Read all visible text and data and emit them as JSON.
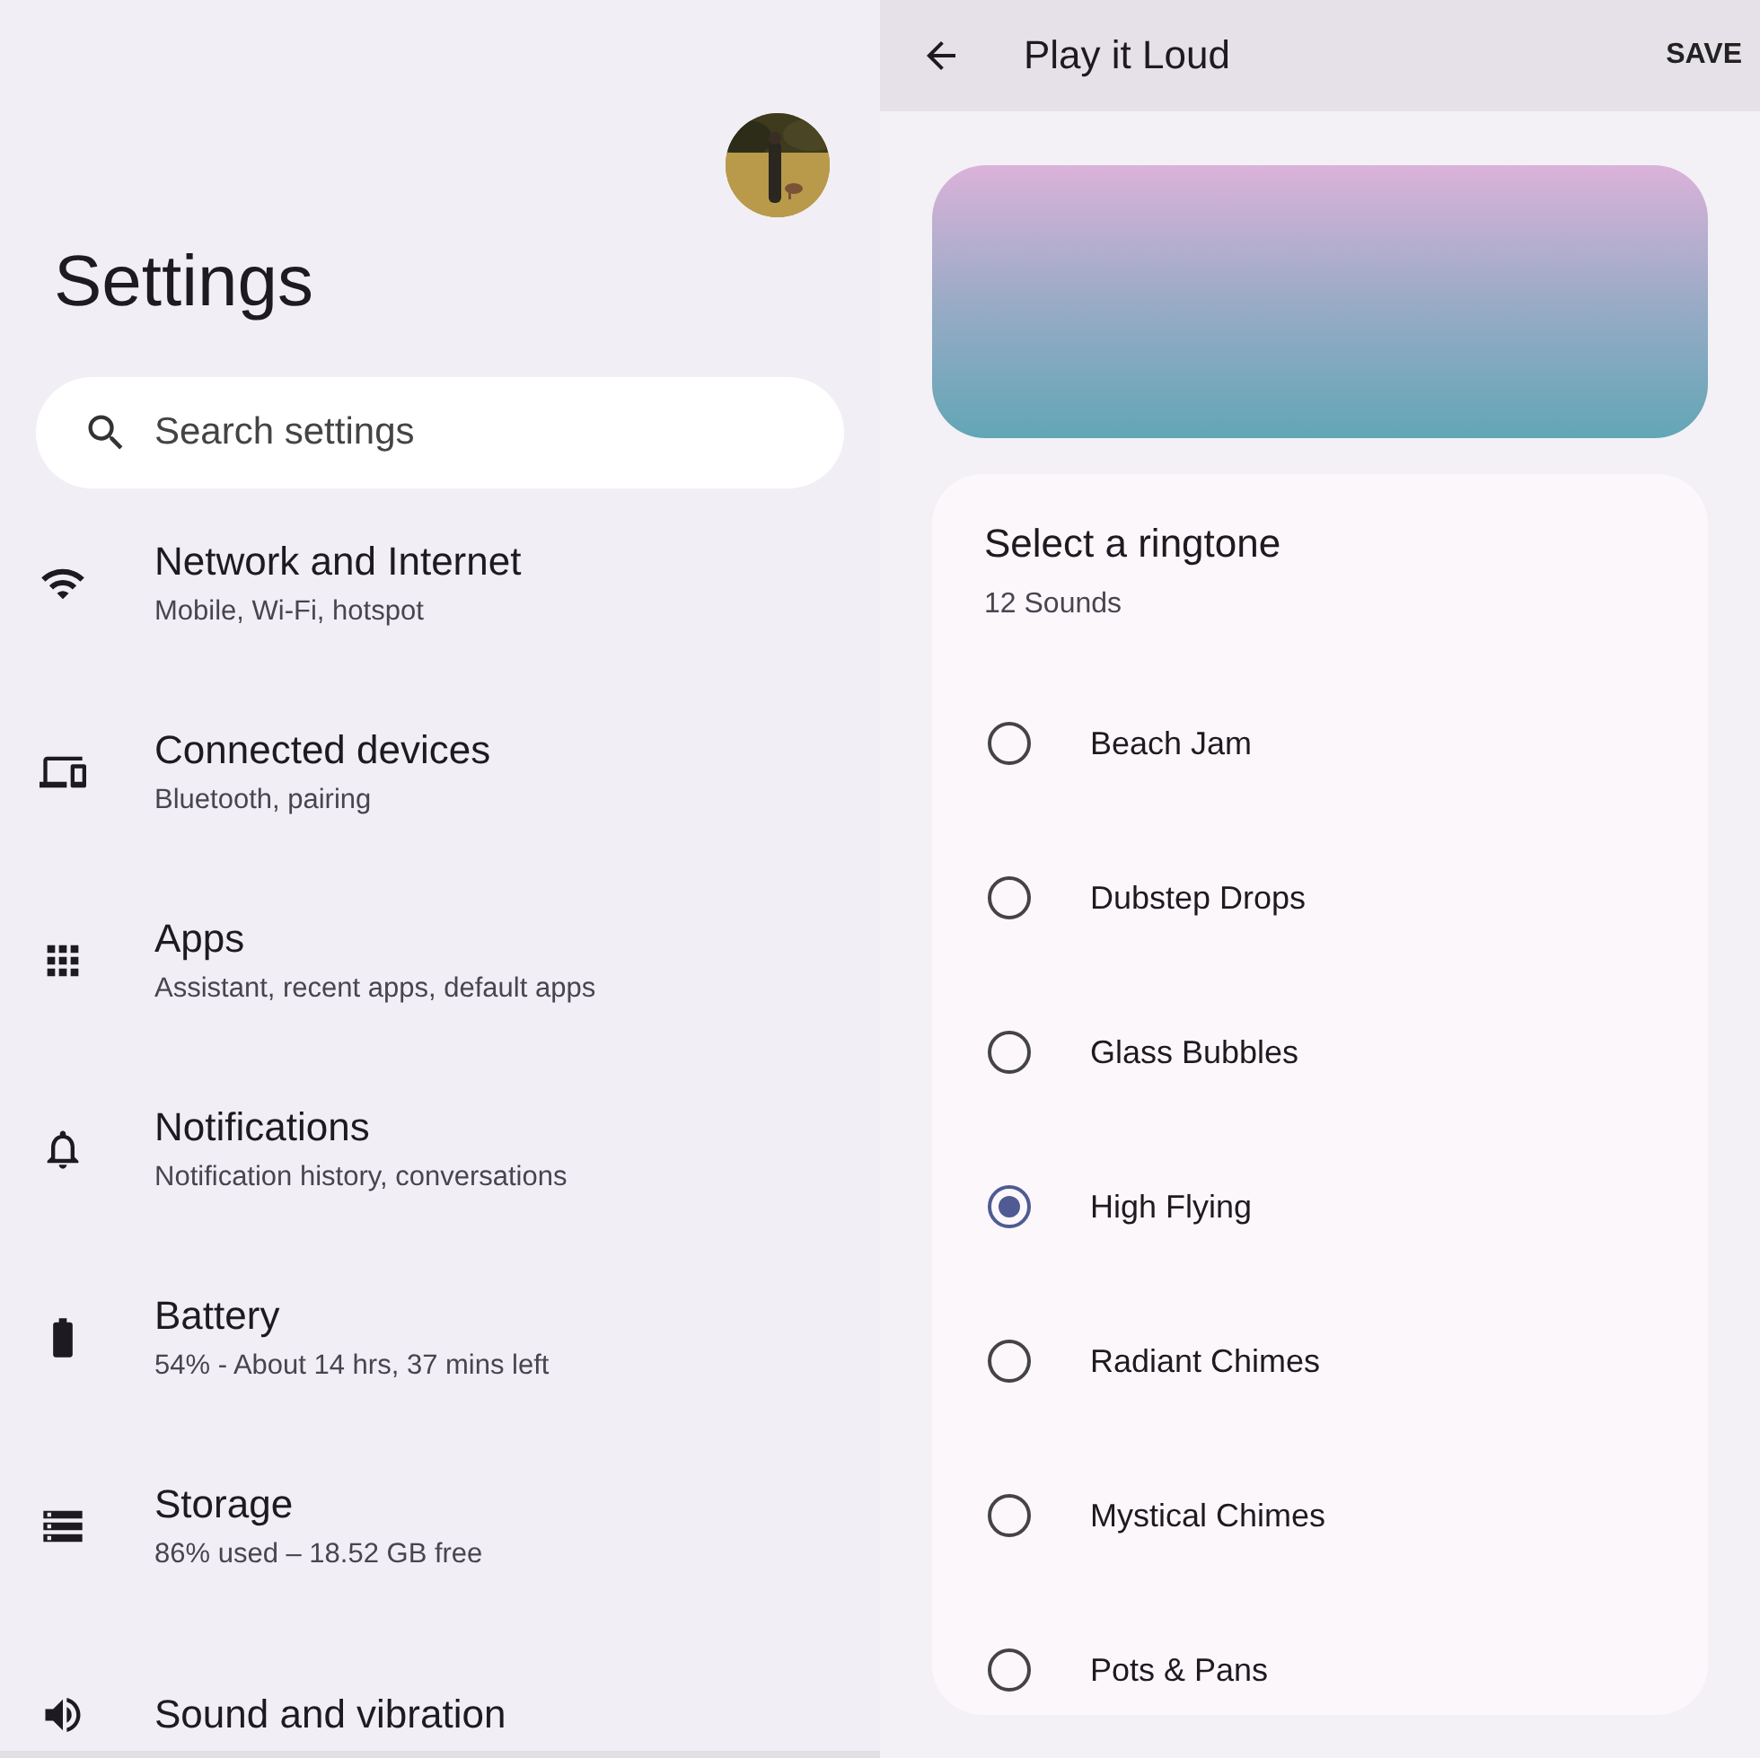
{
  "settings": {
    "title": "Settings",
    "search": {
      "placeholder": "Search settings"
    },
    "items": [
      {
        "title": "Network and Internet",
        "subtitle": "Mobile, Wi-Fi, hotspot"
      },
      {
        "title": "Connected devices",
        "subtitle": "Bluetooth, pairing"
      },
      {
        "title": "Apps",
        "subtitle": "Assistant, recent apps, default apps"
      },
      {
        "title": "Notifications",
        "subtitle": "Notification history, conversations"
      },
      {
        "title": "Battery",
        "subtitle": "54% - About 14 hrs, 37 mins left"
      },
      {
        "title": "Storage",
        "subtitle": "86% used – 18.52 GB free"
      },
      {
        "title": "Sound and vibration"
      }
    ]
  },
  "ringtone": {
    "app_bar": {
      "title": "Play it Loud",
      "action": "SAVE"
    },
    "card": {
      "title": "Select a ringtone",
      "count": "12 Sounds",
      "options": [
        {
          "label": "Beach Jam",
          "selected": false
        },
        {
          "label": "Dubstep Drops",
          "selected": false
        },
        {
          "label": "Glass Bubbles",
          "selected": false
        },
        {
          "label": "High Flying",
          "selected": true
        },
        {
          "label": "Radiant Chimes",
          "selected": false
        },
        {
          "label": "Mystical Chimes",
          "selected": false
        },
        {
          "label": "Pots & Pans",
          "selected": false
        }
      ]
    }
  }
}
